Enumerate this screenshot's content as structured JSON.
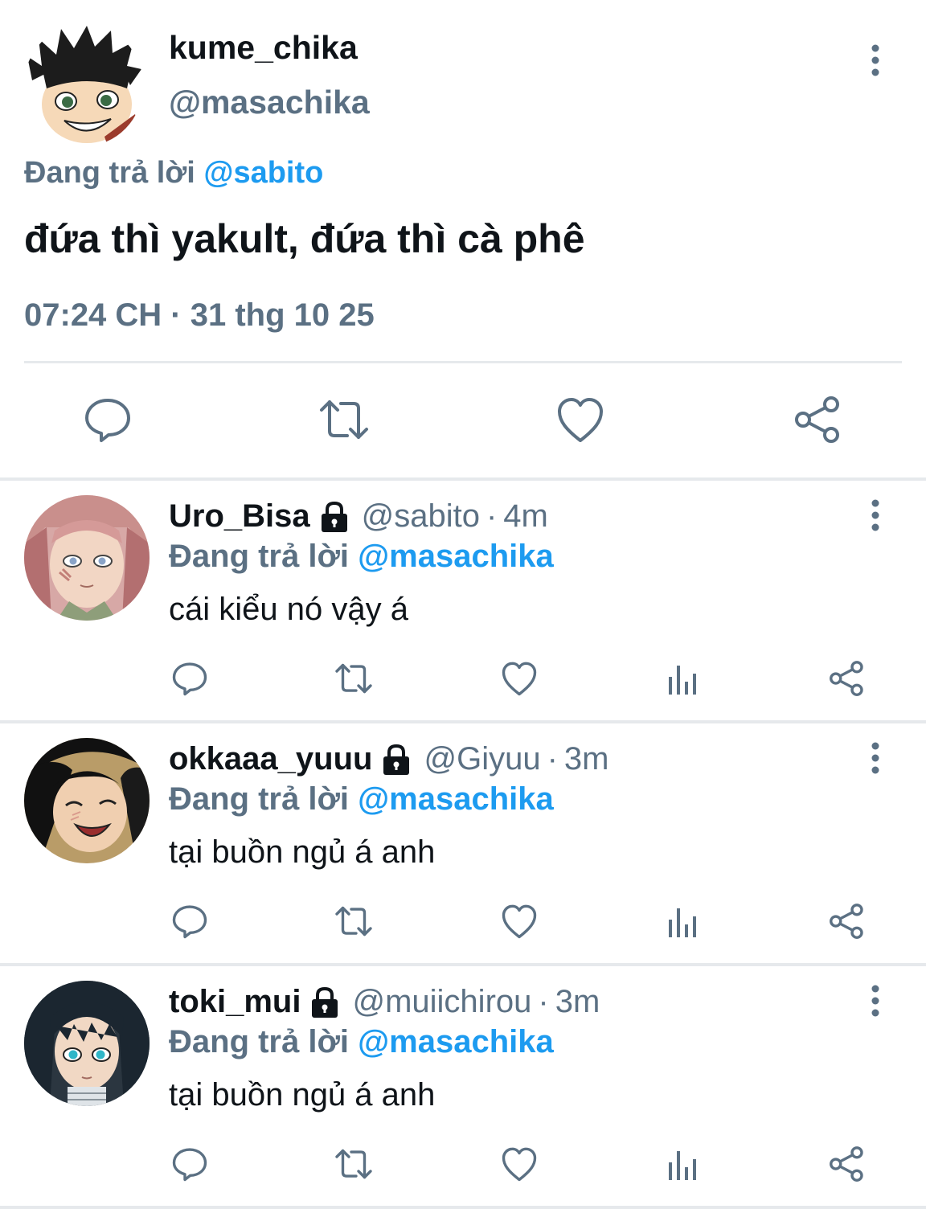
{
  "main_tweet": {
    "display_name": "kume_chika",
    "handle": "@masachika",
    "replying_prefix": "Đang trả lời",
    "replying_to": "@sabito",
    "text": "đứa thì yakult, đứa thì cà phê",
    "timestamp": "07:24 CH · 31 thg 10 25",
    "actions": [
      "reply-icon",
      "retweet-icon",
      "like-icon",
      "share-icon"
    ]
  },
  "replies": [
    {
      "display_name": "Uro_Bisa",
      "handle": "@sabito",
      "separator": "·",
      "time": "4m",
      "replying_prefix": "Đang trả lời",
      "replying_to": "@masachika",
      "text": "cái kiểu nó vậy á"
    },
    {
      "display_name": "okkaaa_yuuu",
      "handle": "@Giyuu",
      "separator": "·",
      "time": "3m",
      "replying_prefix": "Đang trả lời",
      "replying_to": "@masachika",
      "text": "tại buồn ngủ á anh"
    },
    {
      "display_name": "toki_mui",
      "handle": "@muiichirou",
      "separator": "·",
      "time": "3m",
      "replying_prefix": "Đang trả lời",
      "replying_to": "@masachika",
      "text": "tại buồn ngủ á anh"
    }
  ],
  "colors": {
    "text": "#0f1419",
    "secondary": "#5b7083",
    "accent": "#1d9bf0",
    "divider": "#e6e9ec"
  }
}
